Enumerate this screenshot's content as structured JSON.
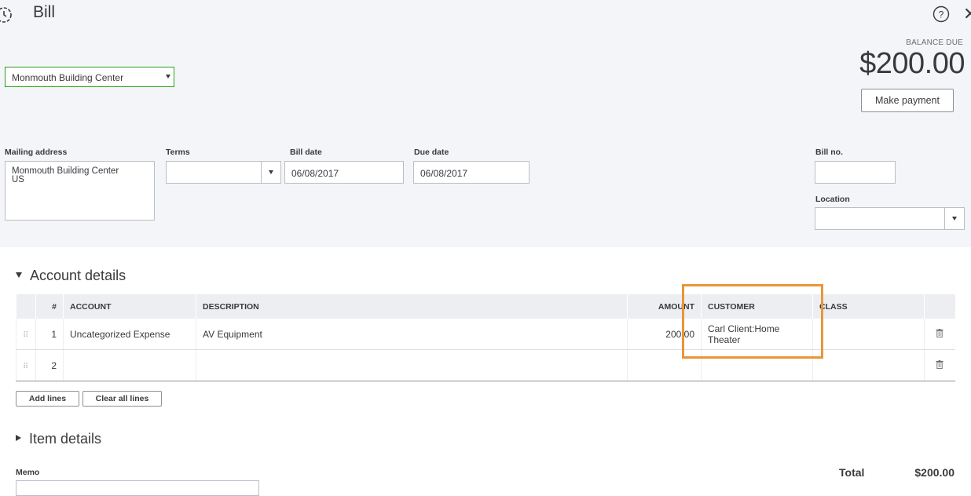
{
  "header": {
    "title": "Bill",
    "history_icon": "history-icon",
    "help_icon": "help-icon",
    "close_icon": "close-icon"
  },
  "vendor": {
    "value": "Monmouth Building Center"
  },
  "balance": {
    "label": "BALANCE DUE",
    "amount": "$200.00",
    "pay_button": "Make payment"
  },
  "fields": {
    "mailing_address_label": "Mailing address",
    "mailing_address_lines": [
      "Monmouth Building Center",
      "US"
    ],
    "terms_label": "Terms",
    "terms_value": "",
    "bill_date_label": "Bill date",
    "bill_date_value": "06/08/2017",
    "due_date_label": "Due date",
    "due_date_value": "06/08/2017",
    "bill_no_label": "Bill no.",
    "bill_no_value": "",
    "location_label": "Location",
    "location_value": ""
  },
  "account_details": {
    "heading": "Account details",
    "columns": [
      "#",
      "ACCOUNT",
      "DESCRIPTION",
      "AMOUNT",
      "CUSTOMER",
      "CLASS"
    ],
    "rows": [
      {
        "num": "1",
        "account": "Uncategorized Expense",
        "description": "AV Equipment",
        "amount": "200.00",
        "customer": "Carl Client:Home Theater",
        "class": ""
      },
      {
        "num": "2",
        "account": "",
        "description": "",
        "amount": "",
        "customer": "",
        "class": ""
      }
    ],
    "add_lines": "Add lines",
    "clear_lines": "Clear all lines"
  },
  "item_details": {
    "heading": "Item details"
  },
  "memo": {
    "label": "Memo",
    "value": ""
  },
  "total": {
    "label": "Total",
    "value": "$200.00"
  },
  "colors": {
    "accent_green": "#2ca01c",
    "highlight_orange": "#e8963a"
  }
}
